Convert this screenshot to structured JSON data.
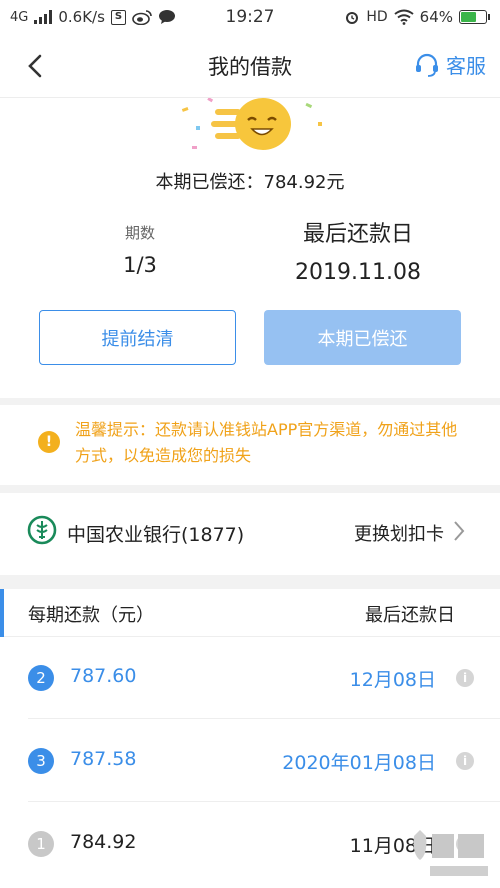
{
  "status_bar": {
    "network": "4G",
    "speed": "0.6K/s",
    "time": "19:27",
    "hd": "HD",
    "battery": "64%",
    "battery_level": 0.64
  },
  "nav": {
    "back_icon": "chevron-left-icon",
    "title": "我的借款",
    "service_icon": "headset-icon",
    "service_label": "客服"
  },
  "summary": {
    "paid_text": "本期已偿还：784.92元",
    "period_label": "期数",
    "period_value": "1/3",
    "due_label": "最后还款日",
    "due_value": "2019.11.08",
    "prepay_button": "提前结清",
    "paid_button": "本期已偿还"
  },
  "notice": {
    "icon": "warning-icon",
    "text": "温馨提示：还款请认准钱站APP官方渠道，勿通过其他方式，以免造成您的损失"
  },
  "bank": {
    "icon": "abc-bank-logo-icon",
    "name": "中国农业银行(1877)",
    "change_label": "更换划扣卡"
  },
  "schedule": {
    "header_amount": "每期还款（元）",
    "header_date": "最后还款日",
    "rows": [
      {
        "num": "2",
        "amount": "787.60",
        "date": "12月08日",
        "status": "pending"
      },
      {
        "num": "3",
        "amount": "787.58",
        "date": "2020年01月08日",
        "status": "pending"
      },
      {
        "num": "1",
        "amount": "784.92",
        "date": "11月08日",
        "status": "paid"
      }
    ]
  },
  "colors": {
    "accent": "#3b8ee8",
    "accent_light": "#96c1f2",
    "warning": "#f0a21a",
    "paid_gray": "#c8c8c8",
    "bank_green": "#1a8a5a"
  }
}
